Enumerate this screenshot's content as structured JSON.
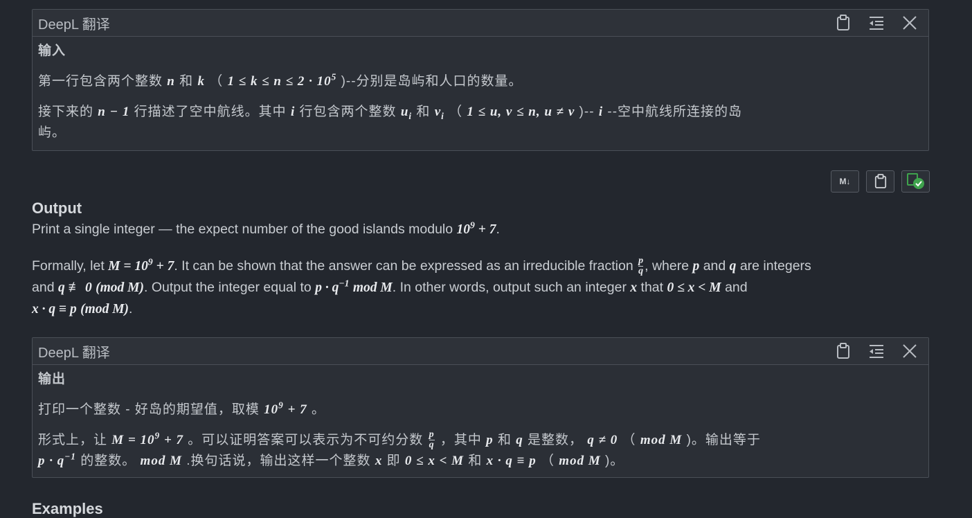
{
  "top_cut_text": "... ... ...",
  "deepl_input": {
    "title": "DeepL 翻译",
    "heading": "输入",
    "line1_pre": "第一行包含两个整数",
    "line1_n": "n",
    "line1_and": "和",
    "line1_k": "k",
    "line1_paren": "（",
    "line1_range": "1 ≤ k ≤ n ≤ 2 · 10",
    "line1_exp": "5",
    "line1_post": ")--分别是岛屿和人口的数量。",
    "line2_pre": "接下来的",
    "line2_nm1": "n − 1",
    "line2_mid": "行描述了空中航线。其中",
    "line2_i": "i",
    "line2_mid2": "行包含两个整数",
    "line2_u": "u",
    "line2_v": "v",
    "line2_sub": "i",
    "line2_and": "和",
    "line2_paren": "（",
    "line2_range": "1 ≤ u, v ≤ n, u ≠ v",
    "line2_post": ")--",
    "line2_post2": "--空中航线所连接的岛",
    "line2_wrap": "屿。"
  },
  "toolbar": {
    "markdown_label": "M↓",
    "copy_label": "",
    "translate_label": ""
  },
  "output": {
    "heading": "Output",
    "p1_pre": "Print a single integer — the expect number of the good islands modulo",
    "p1_math": "10",
    "p1_exp": "9",
    "p1_plus": "+ 7",
    "p1_post": ".",
    "p2_a": "Formally, let",
    "p2_m": "M = 10",
    "p2_exp": "9",
    "p2_plus": "+ 7",
    "p2_b": ". It can be shown that the answer can be expressed as an irreducible fraction",
    "p2_frac_num": "p",
    "p2_frac_den": "q",
    "p2_c": ", where",
    "p2_p": "p",
    "p2_and": "and",
    "p2_q": "q",
    "p2_d": "are integers",
    "p3_a": "and",
    "p3_q": "q ≢ 0",
    "p3_mod": "(mod M)",
    "p3_b": ". Output the integer equal to",
    "p3_expr": "p · q",
    "p3_exp": "−1",
    "p3_mod2": "mod M",
    "p3_c": ". In other words, output such an integer",
    "p3_x": "x",
    "p3_that": "that",
    "p3_ineq": "0 ≤ x < M",
    "p3_and2": "and",
    "p4_expr": "x · q ≡ p",
    "p4_mod": "(mod M)",
    "p4_end": "."
  },
  "deepl_output": {
    "title": "DeepL 翻译",
    "heading": "输出",
    "line1_pre": "打印一个整数 - 好岛的期望值，取模",
    "line1_math": "10",
    "line1_exp": "9",
    "line1_plus": "+ 7",
    "line1_post": "。",
    "line2_a": "形式上，让",
    "line2_m": "M = 10",
    "line2_exp": "9",
    "line2_plus": "+ 7",
    "line2_b": "。可以证明答案可以表示为不可约分数",
    "line2_num": "p",
    "line2_den": "q",
    "line2_c": "，其中",
    "line2_p": "p",
    "line2_and": "和",
    "line2_q": "q",
    "line2_d": "是整数，",
    "line2_ne": "q ≠ 0",
    "line2_paren": "（",
    "line2_mod": "mod M",
    "line2_e": ")。输出等于",
    "line3_expr": "p · q",
    "line3_exp": "−1",
    "line3_a": "的整数。",
    "line3_mod": "mod M",
    "line3_b": ".换句话说，输出这样一个整数",
    "line3_x": "x",
    "line3_ji": "即",
    "line3_ineq": "0 ≤ x < M",
    "line3_and": "和",
    "line3_expr2": "x · q ≡ p",
    "line3_paren": "（",
    "line3_mod2": "mod M",
    "line3_end": ")。"
  },
  "examples": {
    "heading": "Examples"
  }
}
